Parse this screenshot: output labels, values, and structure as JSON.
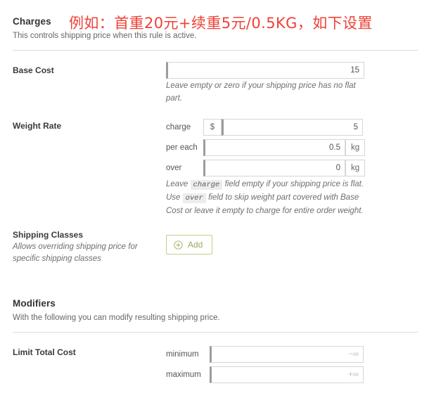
{
  "charges": {
    "title": "Charges",
    "subtitle": "This controls shipping price when this rule is active.",
    "annotation": "例如：首重20元+续重5元/0.5KG，如下设置",
    "base_cost": {
      "label": "Base Cost",
      "value": "15",
      "help": "Leave empty or zero if your shipping price has no flat part."
    },
    "weight_rate": {
      "label": "Weight Rate",
      "charge": {
        "label": "charge",
        "currency_addon": "$",
        "value": "5"
      },
      "per_each": {
        "label": "per each",
        "value": "0.5",
        "unit_addon": "kg"
      },
      "over": {
        "label": "over",
        "value": "0",
        "unit_addon": "kg"
      },
      "help_line1_pre": "Leave",
      "help_line1_code": "charge",
      "help_line1_post": "field empty if your shipping price is flat.",
      "help_line2_pre": "Use",
      "help_line2_code": "over",
      "help_line2_post": "field to skip weight part covered with Base Cost or leave it empty to charge for entire order weight."
    },
    "shipping_classes": {
      "label": "Shipping Classes",
      "description": "Allows overriding shipping price for specific shipping classes",
      "add_button": "Add"
    }
  },
  "modifiers": {
    "title": "Modifiers",
    "subtitle": "With the following you can modify resulting shipping price.",
    "limit_total_cost": {
      "label": "Limit Total Cost",
      "minimum": {
        "label": "minimum",
        "value": "",
        "placeholder": "−∞"
      },
      "maximum": {
        "label": "maximum",
        "value": "",
        "placeholder": "+∞"
      }
    }
  },
  "colors": {
    "annotation_red": "#ef4136",
    "add_button_green": "#9aa85c",
    "add_button_border": "#c3cf8e",
    "input_focus_bar": "#9c9c9c",
    "divider": "#dcdcdc"
  }
}
